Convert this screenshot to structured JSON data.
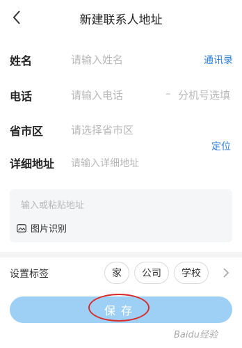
{
  "header": {
    "title": "新建联系人地址"
  },
  "form": {
    "name": {
      "label": "姓名",
      "placeholder": "请输入姓名",
      "action": "通讯录"
    },
    "phone": {
      "label": "电话",
      "placeholder": "请输入电话",
      "separator": "–",
      "extension_placeholder": "分机号选填"
    },
    "region": {
      "label": "省市区",
      "placeholder": "请选择省市区",
      "action": "定位"
    },
    "detail": {
      "label": "详细地址",
      "placeholder": "请输入详细地址"
    }
  },
  "paste": {
    "placeholder": "输入或粘贴地址",
    "ocr_label": "图片识别"
  },
  "tags": {
    "label": "设置标签",
    "items": [
      "家",
      "公司",
      "学校"
    ]
  },
  "save": {
    "label": "保存"
  },
  "watermark": {
    "text": "Baidu经验"
  },
  "colors": {
    "accent": "#2f7fd8",
    "save_bg": "#9ed0f5",
    "highlight": "#d82b2b"
  }
}
